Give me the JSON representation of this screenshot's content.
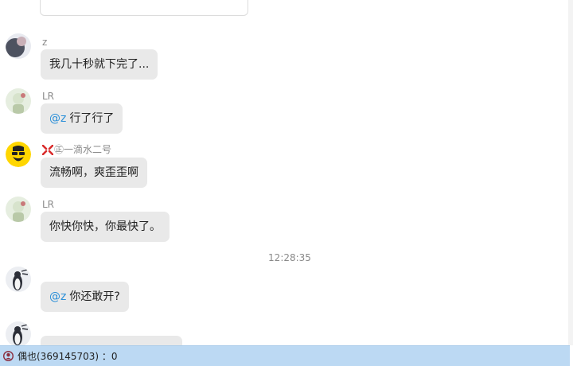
{
  "messages": [
    {
      "sender": "z",
      "mention": "",
      "text": "我几十秒就下完了..."
    },
    {
      "sender": "LR",
      "mention": "@z",
      "text": "行了行了"
    },
    {
      "sender": "㊣一滴水二号",
      "badge_icon": "angry-anime-vein-icon",
      "mention": "",
      "text": "流畅啊，爽歪歪啊"
    },
    {
      "sender": "LR",
      "mention": "",
      "text": "你快你快，你最快了。"
    },
    {
      "sender": "",
      "mention": "@z",
      "text": "你还敢开?"
    },
    {
      "sender": "",
      "mention": "",
      "text": ""
    }
  ],
  "timestamp": "12:28:35",
  "status_bar": {
    "icon": "group-member-icon",
    "text": "偶也(369145703) ：0"
  },
  "colors": {
    "bubble": "#e9e9e9",
    "mention": "#2a8fd8",
    "status_bar": "#bcd9f3"
  }
}
